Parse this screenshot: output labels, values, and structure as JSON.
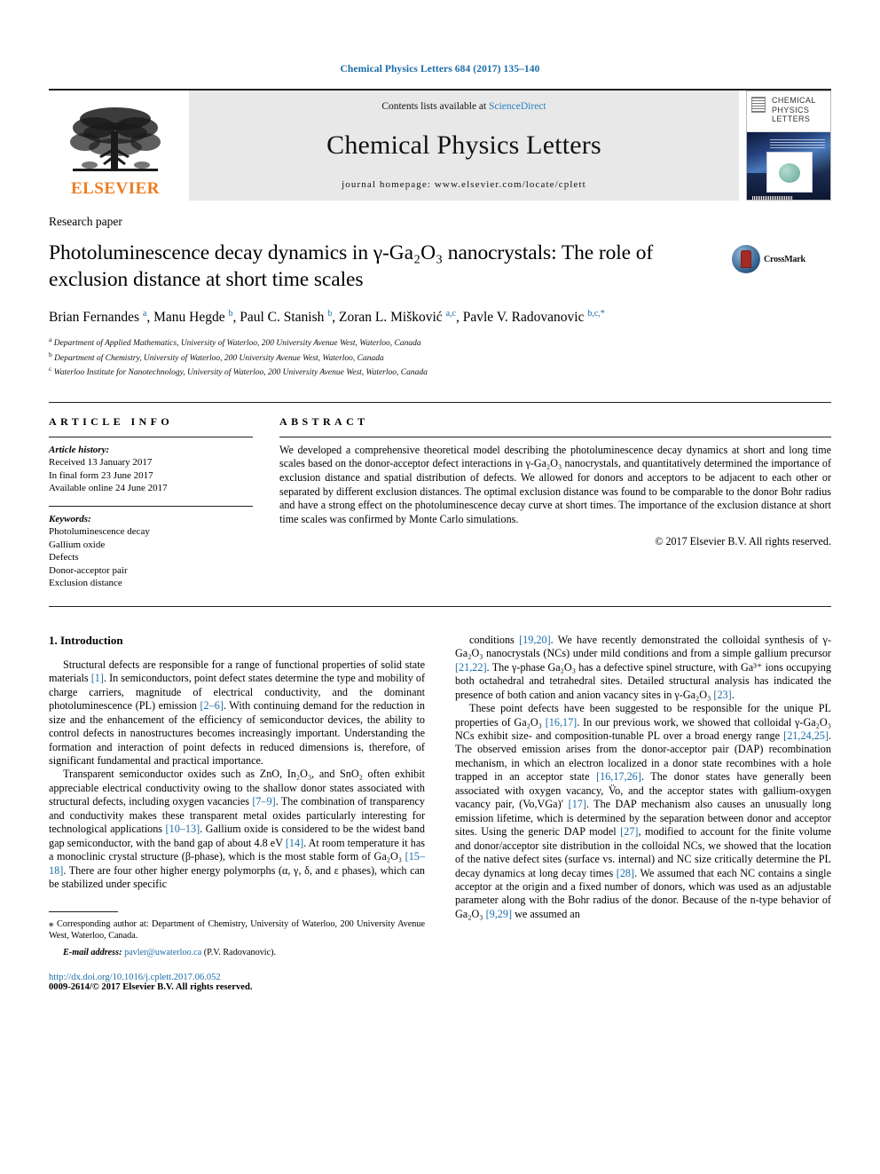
{
  "running_head": "Chemical Physics Letters 684 (2017) 135–140",
  "masthead": {
    "publisher_name": "ELSEVIER",
    "contents_prefix": "Contents lists available at ",
    "contents_link": "ScienceDirect",
    "journal_title": "Chemical Physics Letters",
    "homepage": "journal homepage: www.elsevier.com/locate/cplett",
    "cover_title": "CHEMICAL PHYSICS LETTERS"
  },
  "article": {
    "type": "Research paper",
    "title": "Photoluminescence decay dynamics in γ-Ga₂O₃ nanocrystals: The role of exclusion distance at short time scales",
    "crossmark_label": "CrossMark",
    "authors_html": "Brian Fernandes <sup>a</sup>, Manu Hegde <sup>b</sup>, Paul C. Stanish <sup>b</sup>, Zoran L. Mišković <sup>a,c</sup>, Pavle V. Radovanovic <sup>b,c,</sup><sup>*</sup>",
    "affiliations": [
      {
        "marker": "a",
        "text": "Department of Applied Mathematics, University of Waterloo, 200 University Avenue West, Waterloo, Canada"
      },
      {
        "marker": "b",
        "text": "Department of Chemistry, University of Waterloo, 200 University Avenue West, Waterloo, Canada"
      },
      {
        "marker": "c",
        "text": "Waterloo Institute for Nanotechnology, University of Waterloo, 200 University Avenue West, Waterloo, Canada"
      }
    ]
  },
  "article_info": {
    "heading": "ARTICLE INFO",
    "history_label": "Article history:",
    "history": [
      "Received 13 January 2017",
      "In final form 23 June 2017",
      "Available online 24 June 2017"
    ],
    "keywords_label": "Keywords:",
    "keywords": [
      "Photoluminescence decay",
      "Gallium oxide",
      "Defects",
      "Donor-acceptor pair",
      "Exclusion distance"
    ]
  },
  "abstract": {
    "heading": "ABSTRACT",
    "text": "We developed a comprehensive theoretical model describing the photoluminescence decay dynamics at short and long time scales based on the donor-acceptor defect interactions in γ-Ga₂O₃ nanocrystals, and quantitatively determined the importance of exclusion distance and spatial distribution of defects. We allowed for donors and acceptors to be adjacent to each other or separated by different exclusion distances. The optimal exclusion distance was found to be comparable to the donor Bohr radius and have a strong effect on the photoluminescence decay curve at short times. The importance of the exclusion distance at short time scales was confirmed by Monte Carlo simulations.",
    "copyright": "© 2017 Elsevier B.V. All rights reserved."
  },
  "body": {
    "section_heading": "1. Introduction",
    "left_paragraphs": [
      "Structural defects are responsible for a range of functional properties of solid state materials [1]. In semiconductors, point defect states determine the type and mobility of charge carriers, magnitude of electrical conductivity, and the dominant photoluminescence (PL) emission [2–6]. With continuing demand for the reduction in size and the enhancement of the efficiency of semiconductor devices, the ability to control defects in nanostructures becomes increasingly important. Understanding the formation and interaction of point defects in reduced dimensions is, therefore, of significant fundamental and practical importance.",
      "Transparent semiconductor oxides such as ZnO, In₂O₃, and SnO₂ often exhibit appreciable electrical conductivity owing to the shallow donor states associated with structural defects, including oxygen vacancies [7–9]. The combination of transparency and conductivity makes these transparent metal oxides particularly interesting for technological applications [10–13]. Gallium oxide is considered to be the widest band gap semiconductor, with the band gap of about 4.8 eV [14]. At room temperature it has a monoclinic crystal structure (β-phase), which is the most stable form of Ga₂O₃ [15–18]. There are four other higher energy polymorphs (α, γ, δ, and ε phases), which can be stabilized under specific"
    ],
    "right_paragraphs": [
      "conditions [19,20]. We have recently demonstrated the colloidal synthesis of γ-Ga₂O₃ nanocrystals (NCs) under mild conditions and from a simple gallium precursor [21,22]. The γ-phase Ga₂O₃ has a defective spinel structure, with Ga³⁺ ions occupying both octahedral and tetrahedral sites. Detailed structural analysis has indicated the presence of both cation and anion vacancy sites in γ-Ga₂O₃ [23].",
      "These point defects have been suggested to be responsible for the unique PL properties of Ga₂O₃ [16,17]. In our previous work, we showed that colloidal γ-Ga₂O₃ NCs exhibit size- and composition-tunable PL over a broad energy range [21,24,25]. The observed emission arises from the donor-acceptor pair (DAP) recombination mechanism, in which an electron localized in a donor state recombines with a hole trapped in an acceptor state [16,17,26]. The donor states have generally been associated with oxygen vacancy, V̈o, and the acceptor states with gallium-oxygen vacancy pair, (Vo,VGa)′ [17]. The DAP mechanism also causes an unusually long emission lifetime, which is determined by the separation between donor and acceptor sites. Using the generic DAP model [27], modified to account for the finite volume and donor/acceptor site distribution in the colloidal NCs, we showed that the location of the native defect sites (surface vs. internal) and NC size critically determine the PL decay dynamics at long decay times [28]. We assumed that each NC contains a single acceptor at the origin and a fixed number of donors, which was used as an adjustable parameter along with the Bohr radius of the donor. Because of the n-type behavior of Ga₂O₃ [9,29] we assumed an"
    ]
  },
  "footer": {
    "corresponding_note": "Corresponding author at: Department of Chemistry, University of Waterloo, 200 University Avenue West, Waterloo, Canada.",
    "email_label": "E-mail address:",
    "email": "pavler@uwaterloo.ca",
    "email_owner": "(P.V. Radovanovic).",
    "doi": "http://dx.doi.org/10.1016/j.cplett.2017.06.052",
    "issn_line": "0009-2614/© 2017 Elsevier B.V. All rights reserved."
  },
  "colors": {
    "link": "#1b6ca8",
    "elsevier_orange": "#ef7c20",
    "band_gray": "#e8e8e8"
  }
}
